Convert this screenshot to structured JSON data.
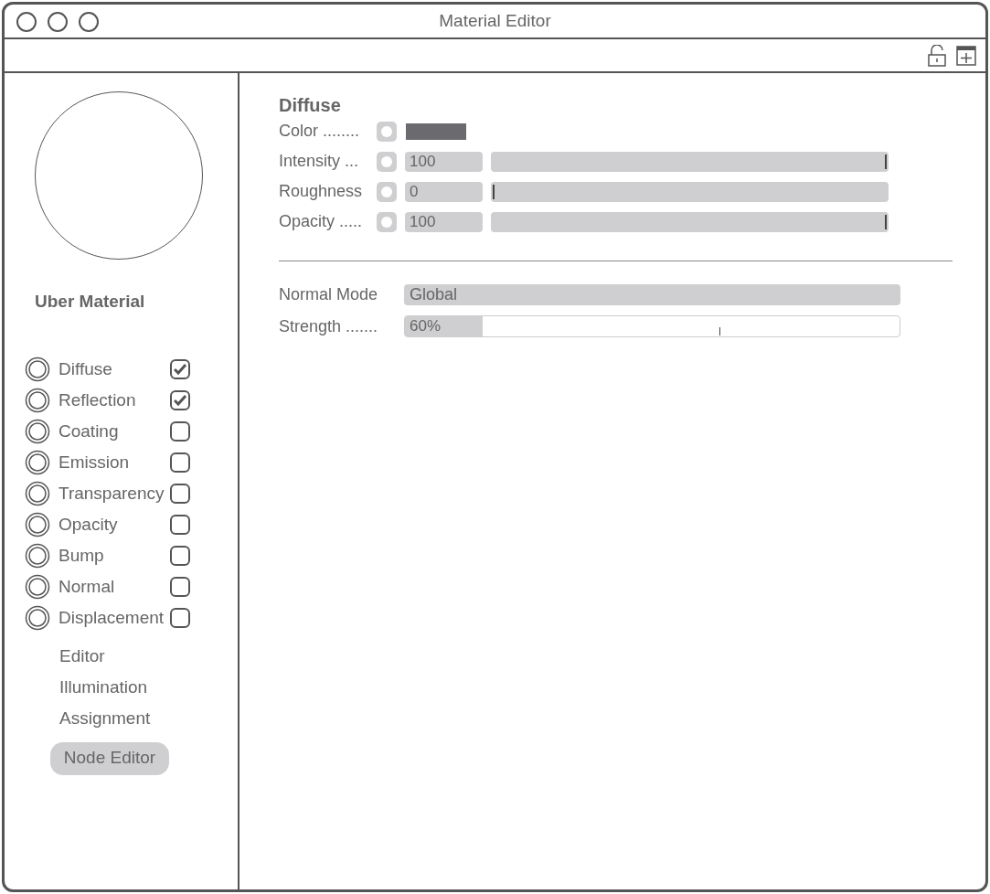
{
  "window": {
    "title": "Material Editor"
  },
  "material": {
    "name": "Uber Material"
  },
  "channels": [
    {
      "name": "Diffuse",
      "checked": true
    },
    {
      "name": "Reflection",
      "checked": true
    },
    {
      "name": "Coating",
      "checked": false
    },
    {
      "name": "Emission",
      "checked": false
    },
    {
      "name": "Transparency",
      "checked": false
    },
    {
      "name": "Opacity",
      "checked": false
    },
    {
      "name": "Bump",
      "checked": false
    },
    {
      "name": "Normal",
      "checked": false
    },
    {
      "name": "Displacement",
      "checked": false
    }
  ],
  "sections": [
    "Editor",
    "Illumination",
    "Assignment"
  ],
  "node_editor_button": "Node Editor",
  "panel": {
    "title": "Diffuse",
    "properties": [
      {
        "kind": "color",
        "label": "Color ........",
        "color": "#6b6b6f"
      },
      {
        "kind": "slider",
        "label": "Intensity ...",
        "value": "100",
        "level": 1
      },
      {
        "kind": "slider",
        "label": "Roughness",
        "value": "0",
        "level": 0
      },
      {
        "kind": "slider",
        "label": "Opacity .....",
        "value": "100",
        "level": 1
      }
    ],
    "normal_mode": {
      "label": "Normal Mode",
      "value": "Global"
    },
    "strength": {
      "label": "Strength .......",
      "value": "60%",
      "level": 0.6
    }
  }
}
